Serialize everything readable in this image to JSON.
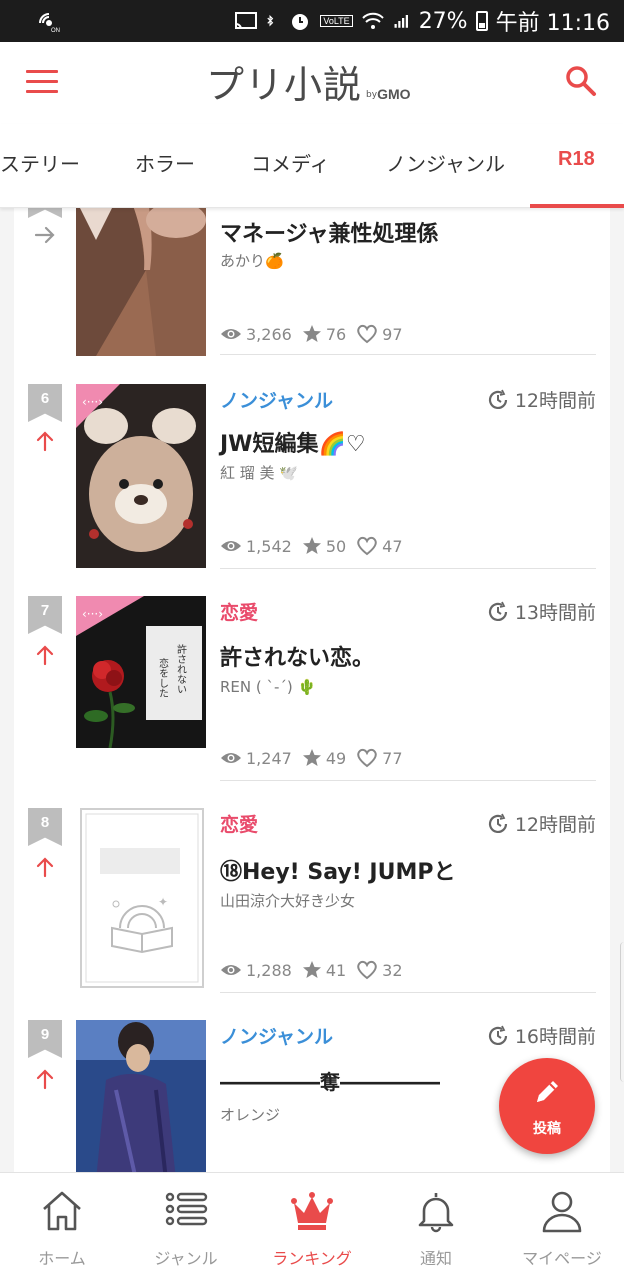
{
  "status_bar": {
    "battery_percent": "27%",
    "time": "午前 11:16",
    "volte": "VoLTE"
  },
  "header": {
    "logo_main": "プリ小説",
    "logo_by": "by",
    "logo_gmo": "GMO"
  },
  "tabs": [
    {
      "label": "ステリー"
    },
    {
      "label": "ホラー"
    },
    {
      "label": "コメディ"
    },
    {
      "label": "ノンジャンル"
    },
    {
      "label": "R18",
      "active": true
    }
  ],
  "items": [
    {
      "title": "マネージャ兼性処理係",
      "author": "あかり🍊",
      "views": "3,266",
      "stars": "76",
      "likes": "97",
      "trend": "same"
    },
    {
      "rank": "6",
      "trend": "up",
      "genre": "ノンジャンル",
      "time": "12時間前",
      "title": "JW短編集🌈♡",
      "author": "紅 瑠 美 🕊️",
      "views": "1,542",
      "stars": "50",
      "likes": "47"
    },
    {
      "rank": "7",
      "trend": "up",
      "genre": "恋愛",
      "time": "13時間前",
      "title": "許されない恋。",
      "author": "REN ( ˋ-ˊ) 🌵",
      "views": "1,247",
      "stars": "49",
      "likes": "77",
      "cover_text": [
        "許されない",
        "恋をした"
      ]
    },
    {
      "rank": "8",
      "trend": "up",
      "genre": "恋愛",
      "time": "12時間前",
      "title": "⑱Hey! Say! JUMPと",
      "author": "山田涼介大好き少女",
      "views": "1,288",
      "stars": "41",
      "likes": "32"
    },
    {
      "rank": "9",
      "trend": "up",
      "genre": "ノンジャンル",
      "time": "16時間前",
      "title": "―――――奪―――――",
      "author": "オレンジ"
    }
  ],
  "fab": {
    "label": "投稿"
  },
  "bottom_nav": [
    {
      "label": "ホーム",
      "icon": "home-icon"
    },
    {
      "label": "ジャンル",
      "icon": "list-icon"
    },
    {
      "label": "ランキング",
      "icon": "crown-icon",
      "active": true
    },
    {
      "label": "通知",
      "icon": "bell-icon"
    },
    {
      "label": "マイページ",
      "icon": "person-icon"
    }
  ],
  "colors": {
    "accent": "#e94b4b",
    "genre_blue": "#3b8fd8",
    "genre_pink": "#e94b6b",
    "fab": "#f0453f",
    "rank_badge": "#bdbdbd"
  }
}
